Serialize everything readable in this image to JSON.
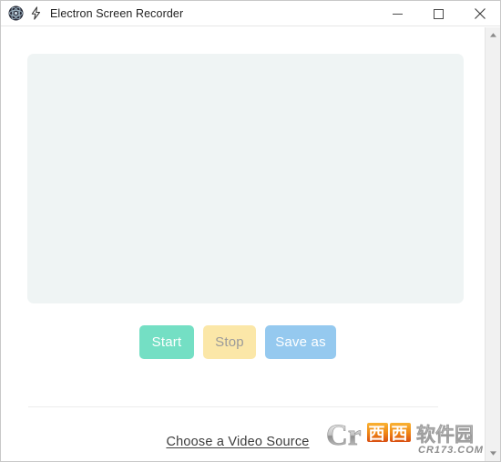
{
  "window": {
    "title": "Electron Screen Recorder",
    "app_icon": "electron-atom-icon",
    "accent_icon": "lightning-bolt-icon",
    "controls": {
      "minimize": "minimize-icon",
      "maximize": "maximize-icon",
      "close": "close-icon"
    }
  },
  "main": {
    "preview": {
      "name": "video-preview-area",
      "background": "#eff4f4",
      "content": ""
    },
    "buttons": [
      {
        "id": "start",
        "label": "Start",
        "bg": "#74dfc4",
        "fg": "#ffffff",
        "enabled": true
      },
      {
        "id": "stop",
        "label": "Stop",
        "bg": "#fbe7a8",
        "fg": "#9a9a9a",
        "enabled": false
      },
      {
        "id": "save_as",
        "label": "Save as",
        "bg": "#95c9ef",
        "fg": "#ffffff",
        "enabled": true
      }
    ],
    "source_link": {
      "label": "Choose a Video Source"
    }
  },
  "scrollbar": {
    "up_arrow": "scroll-up-arrow-icon",
    "down_arrow": "scroll-down-arrow-icon",
    "track_color": "#f1f1f1"
  },
  "watermark": {
    "brand_latin": "Cr",
    "brand_cn": "西西",
    "brand_cn2": "软件园",
    "domain": "CR173.COM",
    "colors": {
      "orange": "#f08a16",
      "red": "#e2451a",
      "silver": "#b9b9b9"
    }
  }
}
